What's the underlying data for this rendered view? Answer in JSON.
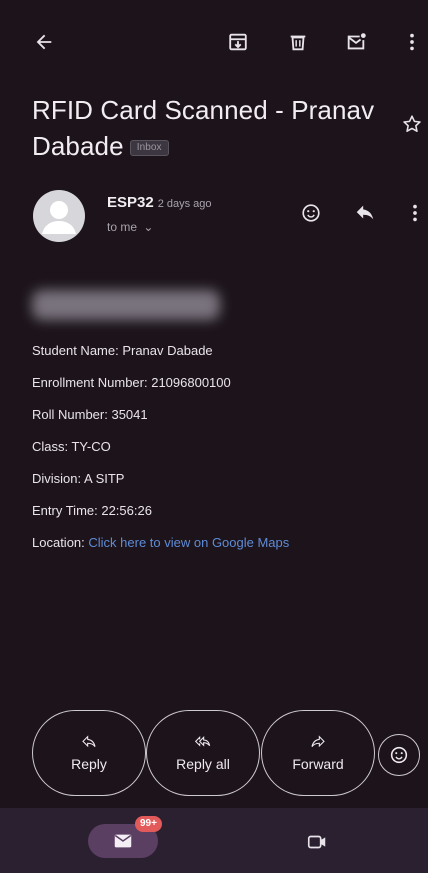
{
  "toolbar": {
    "back_icon": "arrow-left-icon",
    "archive_icon": "archive-icon",
    "delete_icon": "trash-icon",
    "mark_unread_icon": "mark-unread-icon",
    "more_icon": "more-vert-icon"
  },
  "email": {
    "subject": "RFID Card Scanned - Pranav Dabade",
    "label": "Inbox",
    "sender": "ESP32",
    "time": "2 days ago",
    "recipient": "to me",
    "greeting_redacted": true
  },
  "body": {
    "student_name": "Student Name: Pranav Dabade",
    "enrollment": "Enrollment Number: 21096800100",
    "roll": "Roll Number: 35041",
    "class": "Class: TY-CO",
    "division": "Division: A SITP",
    "entry_time": "Entry Time: 22:56:26",
    "location_label": "Location:",
    "location_link": "Click here to view on Google Maps"
  },
  "actions": {
    "reply": "Reply",
    "reply_all": "Reply all",
    "forward": "Forward"
  },
  "bottom_nav": {
    "mail_badge": "99+"
  },
  "colors": {
    "background": "#1c141a",
    "link": "#5f8bd6",
    "badge": "#e25a5a",
    "mail_pill": "#5a3f63"
  }
}
